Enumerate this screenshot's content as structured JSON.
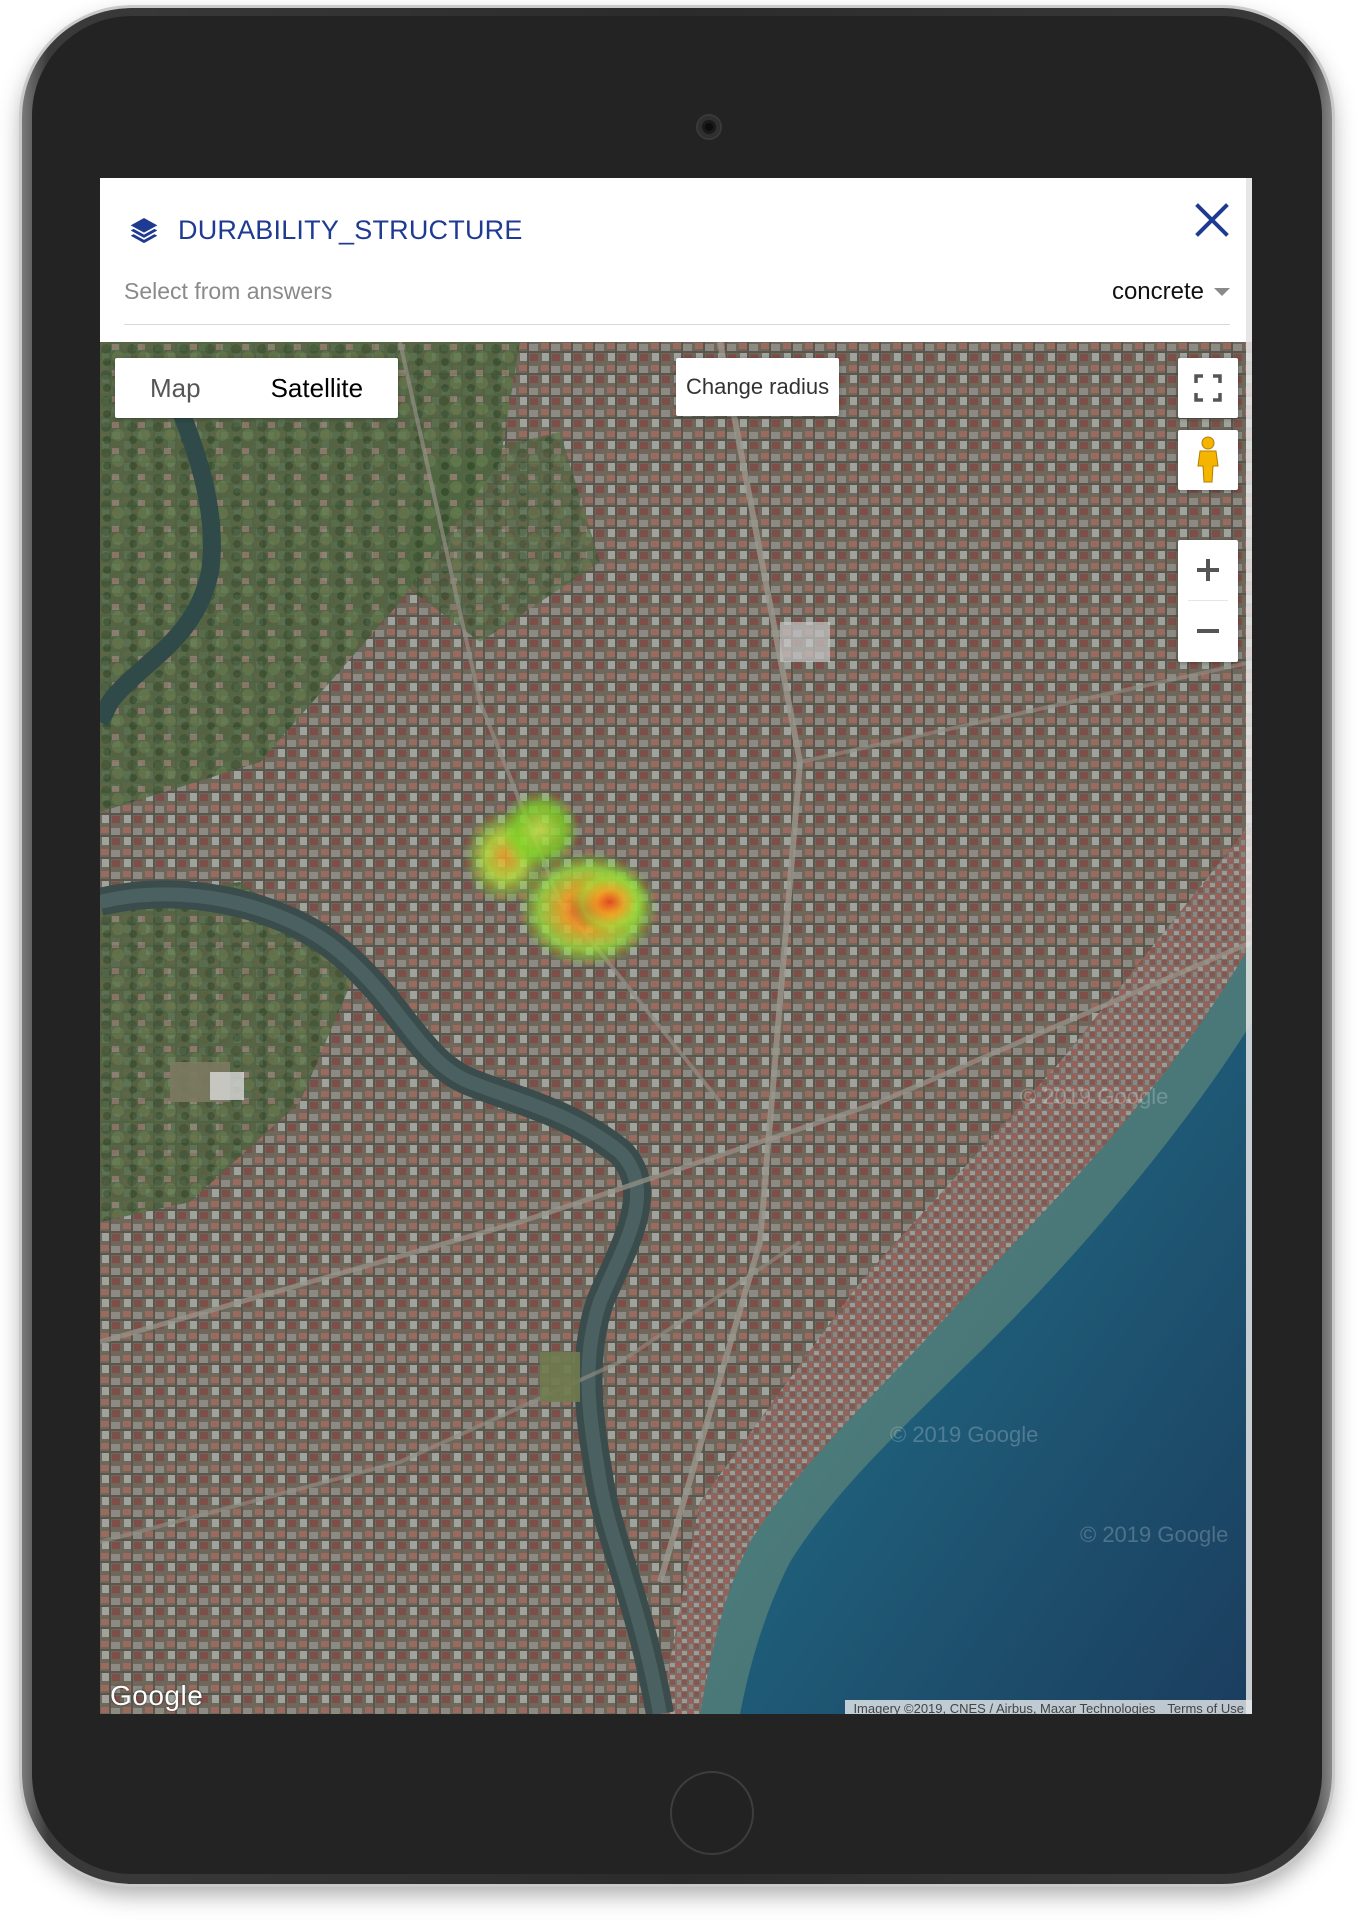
{
  "header": {
    "title": "DURABILITY_STRUCTURE",
    "layers_icon": "layers-icon",
    "close_icon": "close-icon"
  },
  "select": {
    "placeholder": "Select from answers",
    "value": "concrete"
  },
  "map": {
    "type_buttons": [
      "Map",
      "Satellite"
    ],
    "active_type": "Satellite",
    "change_radius_label": "Change radius",
    "controls": [
      "fullscreen-icon",
      "pegman-icon",
      "zoom-in-icon",
      "zoom-out-icon"
    ],
    "google_logo": "Google",
    "attribution": "Imagery ©2019, CNES / Airbus, Maxar Technologies",
    "terms": "Terms of Use",
    "watermark": "© 2019 Google"
  },
  "colors": {
    "title": "#1f3a93",
    "accent": "#1f3a93",
    "heat_low": "#7ed321",
    "heat_mid": "#f5a623",
    "heat_high": "#e0301e"
  }
}
